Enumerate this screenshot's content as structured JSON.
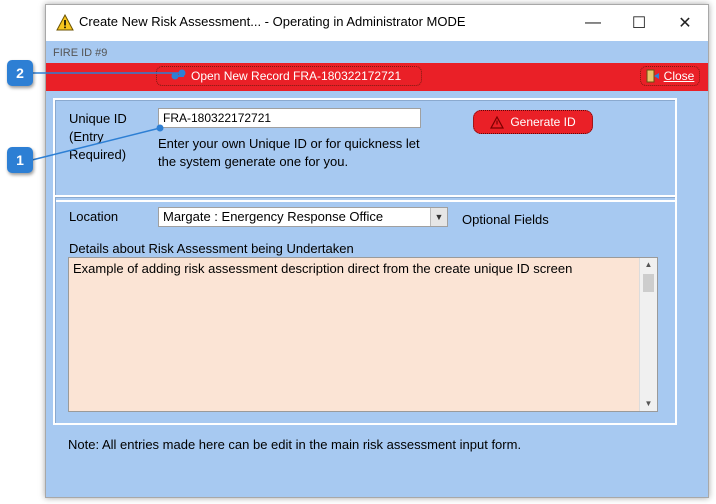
{
  "window": {
    "title": "Create New Risk Assessment... - Operating in Administrator MODE",
    "fire_id": "FIRE ID #9"
  },
  "toolbar": {
    "open_label": "Open New Record FRA-180322172721",
    "close_label": "Close"
  },
  "id_section": {
    "label_line1": "Unique ID",
    "label_line2": "(Entry",
    "label_line3": "Required)",
    "value": "FRA-180322172721",
    "help_line1": "Enter your own Unique ID or for quickness let",
    "help_line2": "the system generate one for you.",
    "generate_label": "Generate ID"
  },
  "details_section": {
    "location_label": "Location",
    "location_value": "Margate : Energency Response Office",
    "optional_label": "Optional Fields",
    "details_label": "Details about Risk Assessment being Undertaken",
    "details_value": "Example of adding risk assessment description direct from the create unique ID screen"
  },
  "note": "Note: All entries made here can be edit in the main risk assessment input form.",
  "callouts": {
    "one": "1",
    "two": "2"
  },
  "colors": {
    "accent_red": "#ea2027",
    "client_bg": "#a7c9f1",
    "textarea_bg": "#fbe4d5",
    "callout_blue": "#2d7fd4"
  },
  "icons": [
    "warning-icon",
    "minimize-icon",
    "maximize-icon",
    "close-icon",
    "open-record-icon",
    "exit-icon",
    "generate-icon",
    "chevron-down-icon"
  ]
}
